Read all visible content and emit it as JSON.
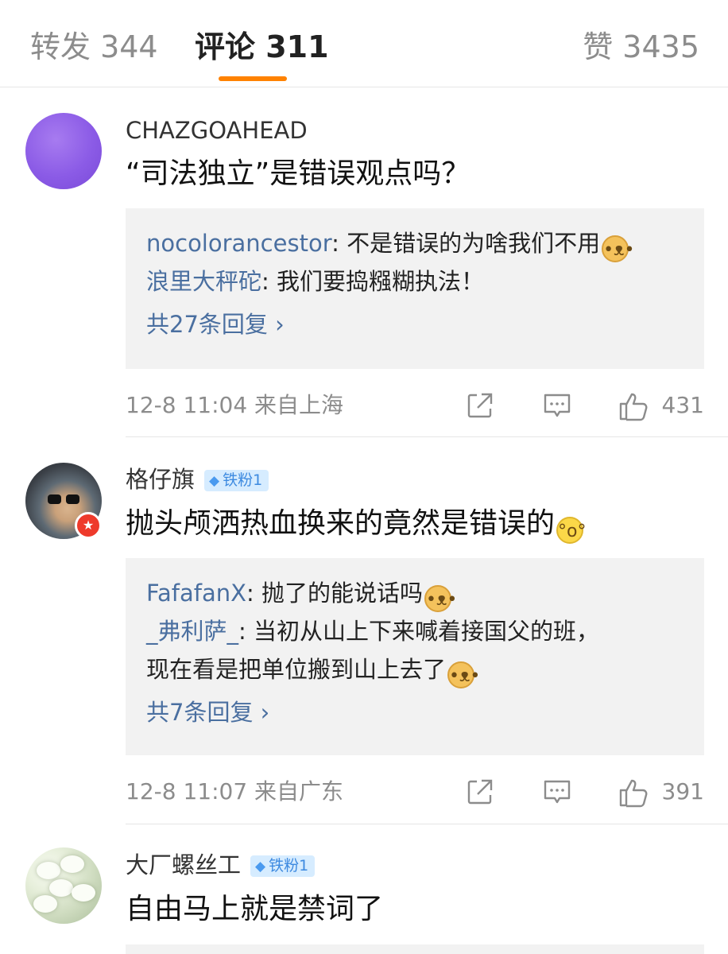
{
  "tabs": {
    "repost": "转发 344",
    "comment": "评论 311",
    "like": "赞 3435"
  },
  "colors": {
    "accent": "#ff8200",
    "link": "#4a6fa0",
    "reply_bg": "#f2f2f2"
  },
  "comments": [
    {
      "username": "CHAZGOAHEAD",
      "text": "“司法独立”是错误观点吗？",
      "replies": [
        {
          "name": "nocolorancestor",
          "sep": ": ",
          "text": "不是错误的为啥我们不用"
        },
        {
          "name": "浪里大秤砣",
          "sep": ": ",
          "text": "我们要捣糨糊执法！"
        }
      ],
      "more": "共27条回复 ›",
      "time": "12-8 11:04  来自上海",
      "likes": "431"
    },
    {
      "username": "格仔旗",
      "badge": "铁粉1",
      "text": "抛头颅洒热血换来的竟然是错误的",
      "replies": [
        {
          "name": "FafafanX",
          "sep": ": ",
          "text": "抛了的能说话吗"
        },
        {
          "name": "_弗利萨_",
          "sep": ": ",
          "text": "当初从山上下来喊着接国父的班，",
          "line2": "现在看是把单位搬到山上去了"
        }
      ],
      "more": "共7条回复 ›",
      "time": "12-8 11:07  来自广东",
      "likes": "391"
    },
    {
      "username": "大厂螺丝工",
      "badge": "铁粉1",
      "text": "自由马上就是禁词了"
    }
  ],
  "icons": {
    "share": "share-icon",
    "reply": "comment-icon",
    "like": "thumbs-up-icon",
    "verify": "verified-star-icon",
    "fan": "diamond-icon"
  }
}
